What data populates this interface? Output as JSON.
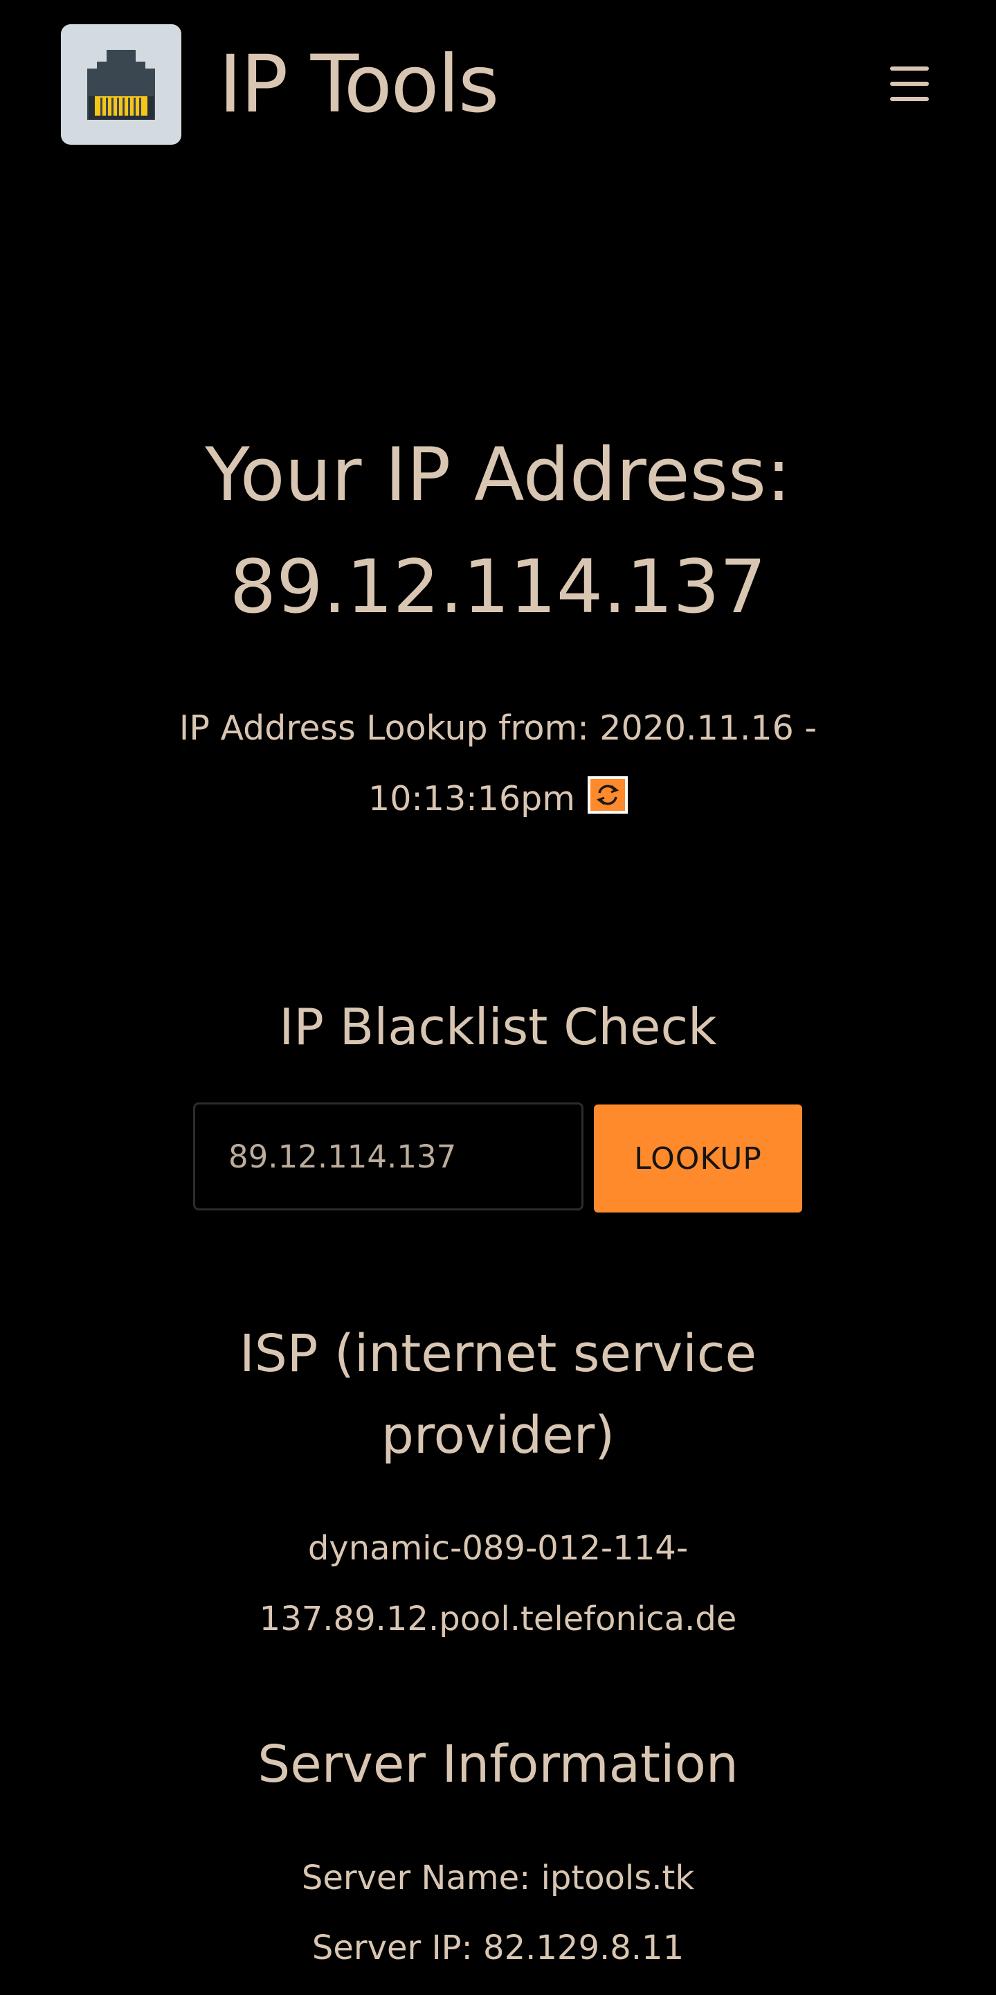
{
  "header": {
    "site_title": "IP Tools",
    "logo_icon": "ethernet-port-icon",
    "menu_icon": "hamburger-menu-icon"
  },
  "ip_info": {
    "heading_label": "Your IP Address:",
    "ip_address": "89.12.114.137",
    "lookup_label": "IP Address Lookup from:",
    "lookup_date": "2020.11.16 -",
    "lookup_time": "10:13:16pm",
    "refresh_icon": "refresh-icon"
  },
  "blacklist": {
    "title": "IP Blacklist Check",
    "input_value": "89.12.114.137",
    "button_label": "LOOKUP"
  },
  "isp": {
    "title_line1": "ISP (internet service",
    "title_line2": "provider)",
    "host_line1": "dynamic-089-012-114-",
    "host_line2": "137.89.12.pool.telefonica.de"
  },
  "server": {
    "title": "Server Information",
    "name_label": "Server Name:",
    "name_value": "iptools.tk",
    "ip_label": "Server IP:",
    "ip_value": "82.129.8.11"
  },
  "colors": {
    "background": "#000000",
    "text": "#d9c6b2",
    "accent": "#ff8a2b",
    "logo_bg": "#d4dbe0",
    "port_body": "#3a4650",
    "port_pins": "#f5c518"
  }
}
